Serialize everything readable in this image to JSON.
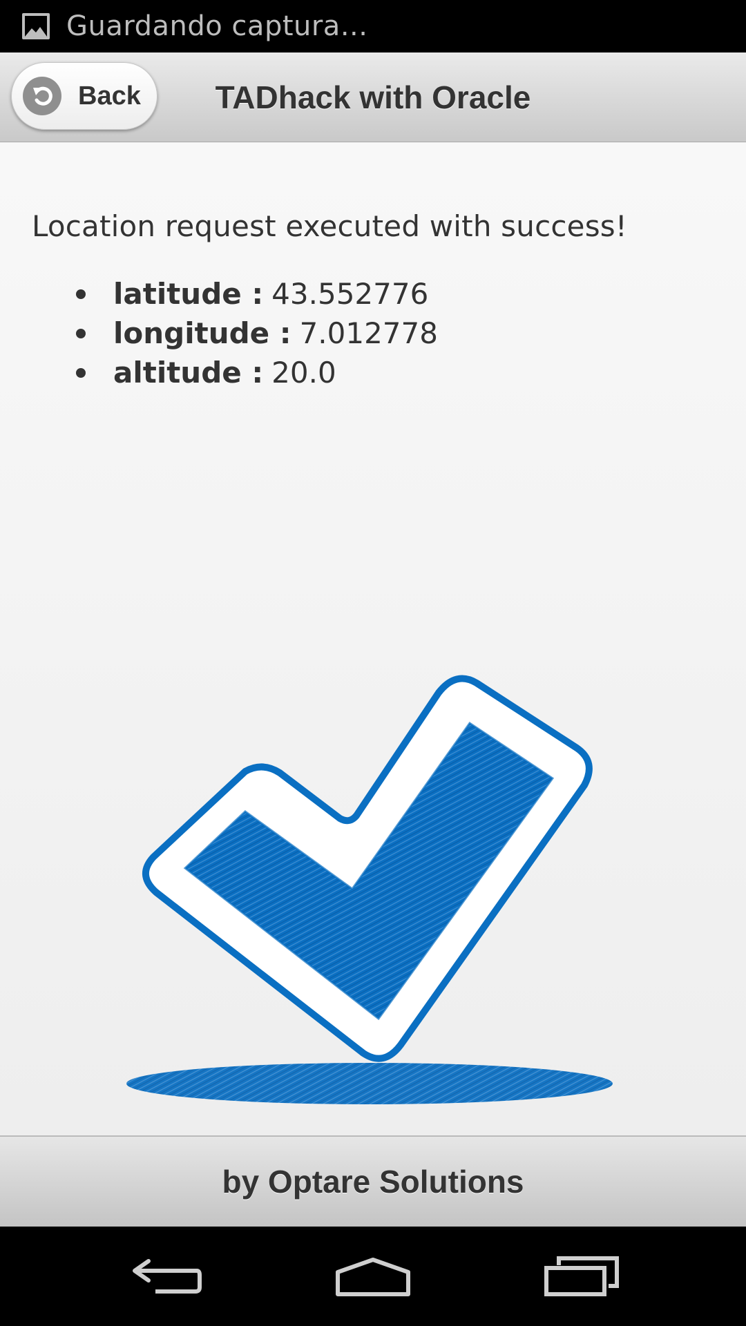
{
  "status_bar": {
    "notification_icon": "image-icon",
    "text": "Guardando captura..."
  },
  "header": {
    "back_label": "Back",
    "title": "TADhack with Oracle"
  },
  "content": {
    "message": "Location request executed with success!",
    "location": [
      {
        "key": "latitude :",
        "value": "43.552776"
      },
      {
        "key": "longitude :",
        "value": "7.012778"
      },
      {
        "key": "altitude :",
        "value": "20.0"
      }
    ],
    "illustration": "checkmark-icon",
    "accent_color": "#0a6fc2"
  },
  "footer": {
    "text": "by Optare Solutions"
  },
  "nav_bar": {
    "icons": [
      "nav-back-icon",
      "nav-home-icon",
      "nav-recents-icon"
    ]
  }
}
